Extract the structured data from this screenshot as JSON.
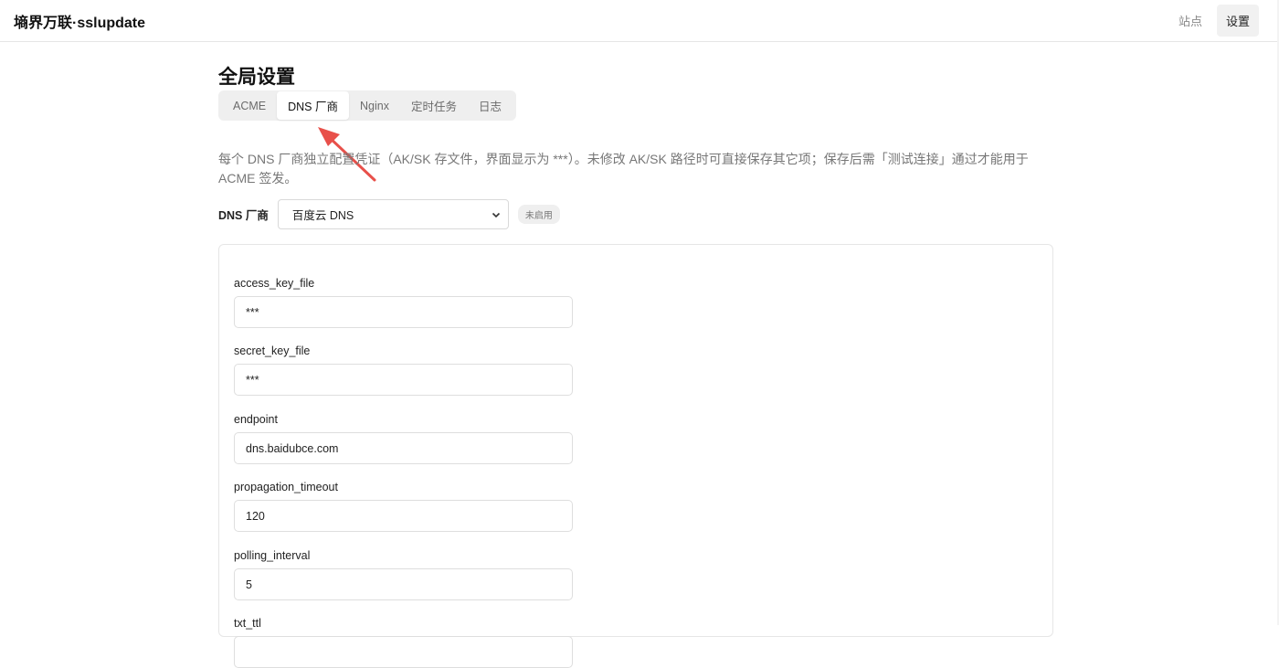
{
  "app": {
    "brand": "墒界万联·sslupdate"
  },
  "topnav": {
    "sites": "站点",
    "settings": "设置"
  },
  "page": {
    "title": "全局设置"
  },
  "tabs": [
    {
      "label": "ACME"
    },
    {
      "label": "DNS 厂商"
    },
    {
      "label": "Nginx"
    },
    {
      "label": "定时任务"
    },
    {
      "label": "日志"
    }
  ],
  "description": "每个 DNS 厂商独立配置凭证（AK/SK 存文件，界面显示为 ***）。未修改 AK/SK 路径时可直接保存其它项；保存后需「测试连接」通过才能用于 ACME 签发。",
  "provider": {
    "label": "DNS 厂商",
    "selected": "百度云 DNS",
    "status": "未启用"
  },
  "fields": [
    {
      "label": "access_key_file",
      "value": "***"
    },
    {
      "label": "secret_key_file",
      "value": "***"
    },
    {
      "label": "endpoint",
      "value": "dns.baidubce.com"
    },
    {
      "label": "propagation_timeout",
      "value": "120"
    },
    {
      "label": "polling_interval",
      "value": "5"
    },
    {
      "label": "txt_ttl",
      "value": ""
    }
  ],
  "colors": {
    "arrow": "#e8504a",
    "active_tab_bg": "#ffffff",
    "tabs_bg": "#efefef"
  }
}
